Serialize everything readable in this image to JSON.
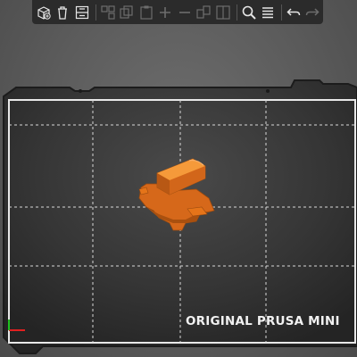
{
  "toolbar": {
    "buttons": [
      {
        "name": "add-object",
        "icon": "add-cube-icon",
        "enabled": true
      },
      {
        "name": "delete",
        "icon": "trash-icon",
        "enabled": true
      },
      {
        "name": "delete-all",
        "icon": "delete-all-icon",
        "enabled": true
      },
      {
        "name": "arrange",
        "icon": "arrange-icon",
        "enabled": false
      },
      {
        "name": "copy",
        "icon": "copy-icon",
        "enabled": false
      },
      {
        "name": "paste",
        "icon": "paste-icon",
        "enabled": false
      },
      {
        "name": "add-instance",
        "icon": "plus-icon",
        "enabled": false
      },
      {
        "name": "remove-instance",
        "icon": "minus-icon",
        "enabled": false
      },
      {
        "name": "split-objects",
        "icon": "split-objects-icon",
        "enabled": false
      },
      {
        "name": "split-parts",
        "icon": "split-parts-icon",
        "enabled": false
      },
      {
        "name": "search",
        "icon": "search-icon",
        "enabled": true
      },
      {
        "name": "layers",
        "icon": "layers-icon",
        "enabled": true
      },
      {
        "name": "undo",
        "icon": "undo-icon",
        "enabled": true
      },
      {
        "name": "redo",
        "icon": "redo-icon",
        "enabled": false
      }
    ]
  },
  "bed": {
    "label": "ORIGINAL PRUSA MINI"
  },
  "colors": {
    "object": "#e8731a",
    "bed_surface": "#333333",
    "grid": "#d8d8d8",
    "toolbar_bg": "#2b2b2b"
  }
}
